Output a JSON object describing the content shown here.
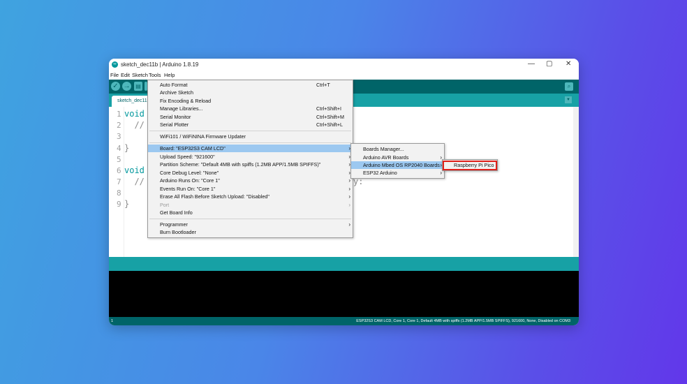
{
  "window": {
    "title": "sketch_dec11b | Arduino 1.8.19",
    "controls": {
      "minimize": "—",
      "maximize": "▢",
      "close": "✕"
    }
  },
  "menubar": {
    "file": "File",
    "edit": "Edit",
    "sketch": "Sketch",
    "tools": "Tools",
    "help": "Help"
  },
  "toolbar": {
    "verify": "✓",
    "upload": "→",
    "new": "▤"
  },
  "tab": {
    "label": "sketch_dec11"
  },
  "editor": {
    "line_numbers": [
      "1",
      "2",
      "3",
      "4",
      "5",
      "6",
      "7",
      "8",
      "9"
    ],
    "code": {
      "l1": "void",
      "l2": "  //",
      "l4": "}",
      "l6": "void",
      "l7": "  //",
      "l7_tail": "y:",
      "l9": "}"
    }
  },
  "tools_menu": {
    "items": [
      {
        "label": "Auto Format",
        "shortcut": "Ctrl+T"
      },
      {
        "label": "Archive Sketch",
        "shortcut": ""
      },
      {
        "label": "Fix Encoding & Reload",
        "shortcut": ""
      },
      {
        "label": "Manage Libraries...",
        "shortcut": "Ctrl+Shift+I"
      },
      {
        "label": "Serial Monitor",
        "shortcut": "Ctrl+Shift+M"
      },
      {
        "label": "Serial Plotter",
        "shortcut": "Ctrl+Shift+L"
      },
      {
        "label": "WiFi101 / WiFiNINA Firmware Updater",
        "shortcut": ""
      },
      {
        "label": "Board: \"ESP32S3 CAM LCD\"",
        "shortcut": ""
      },
      {
        "label": "Upload Speed: \"921600\"",
        "shortcut": ""
      },
      {
        "label": "Partition Scheme: \"Default 4MB with spiffs (1.2MB APP/1.5MB SPIFFS)\"",
        "shortcut": ""
      },
      {
        "label": "Core Debug Level: \"None\"",
        "shortcut": ""
      },
      {
        "label": "Arduino Runs On: \"Core 1\"",
        "shortcut": ""
      },
      {
        "label": "Events Run On: \"Core 1\"",
        "shortcut": ""
      },
      {
        "label": "Erase All Flash Before Sketch Upload: \"Disabled\"",
        "shortcut": ""
      },
      {
        "label": "Port",
        "shortcut": ""
      },
      {
        "label": "Get Board Info",
        "shortcut": ""
      },
      {
        "label": "Programmer",
        "shortcut": ""
      },
      {
        "label": "Burn Bootloader",
        "shortcut": ""
      }
    ]
  },
  "board_submenu": {
    "items": [
      {
        "label": "Boards Manager..."
      },
      {
        "label": "Arduino AVR Boards"
      },
      {
        "label": "Arduino Mbed OS RP2040 Boards"
      },
      {
        "label": "ESP32 Arduino"
      }
    ]
  },
  "rp2040_submenu": {
    "items": [
      {
        "label": "Raspberry Pi Pico"
      }
    ]
  },
  "statusbar": {
    "line": "1",
    "text": "ESP32S3 CAM LCD, Core 1, Core 1, Default 4MB with spiffs (1.2MB APP/1.5MB SPIFFS), 921600, None, Disabled on COM3"
  },
  "colors": {
    "toolbar": "#006468",
    "tabbar": "#17a1a5",
    "highlight": "#9cc8f0",
    "selection_box": "#e0201b"
  }
}
